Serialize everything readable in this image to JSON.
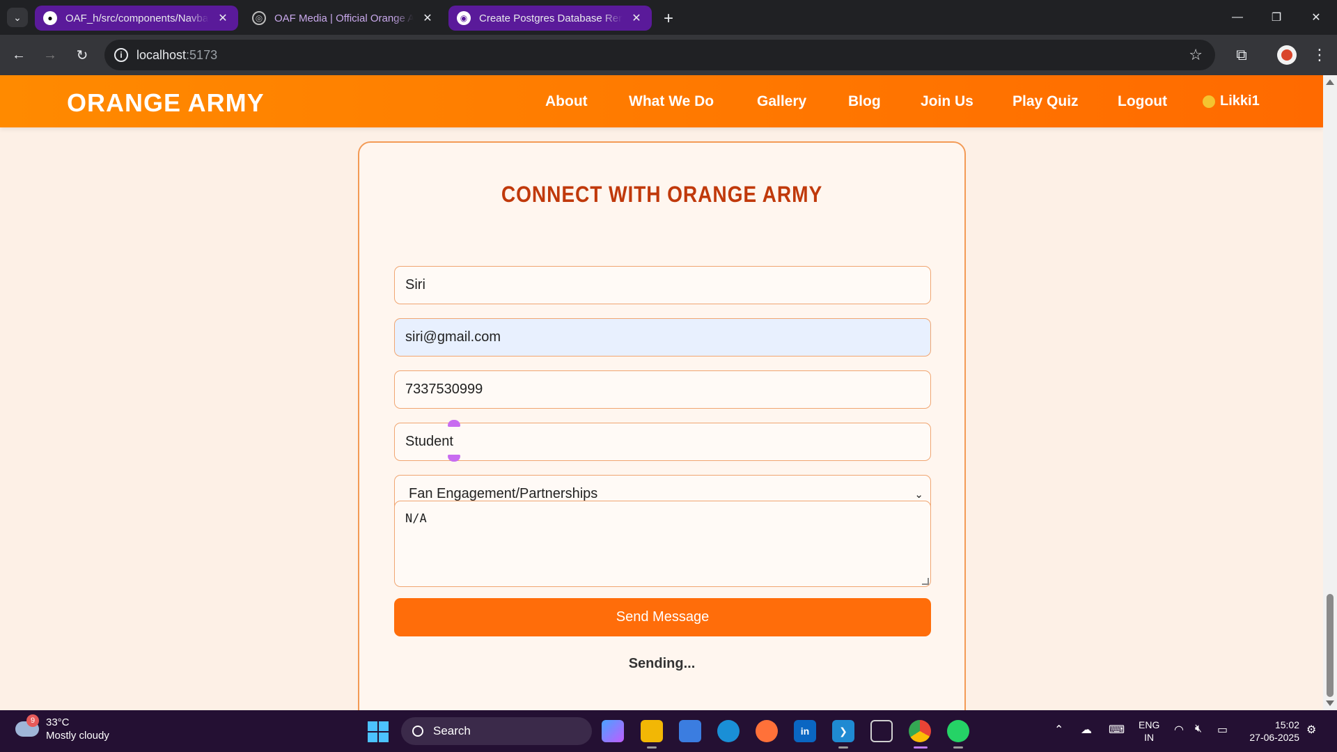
{
  "browser": {
    "tabs": [
      {
        "title": "OAF_h/src/components/Navbar"
      },
      {
        "title": "OAF Media | Official Orange Army"
      },
      {
        "title": "Create Postgres Database Render"
      }
    ],
    "url": {
      "host": "localhost",
      "port": ":5173"
    }
  },
  "site": {
    "logo": "ORANGE ARMY",
    "nav": [
      "About",
      "What We Do",
      "Gallery",
      "Blog",
      "Join Us",
      "Play Quiz",
      "Logout"
    ],
    "user": "Likki1"
  },
  "form": {
    "title": "CONNECT WITH ORANGE ARMY",
    "name": "Siri",
    "email": "siri@gmail.com",
    "phone": "7337530999",
    "occupation": "Student",
    "interest": "Fan Engagement/Partnerships",
    "message": "N/A",
    "submit": "Send Message",
    "status": "Sending..."
  },
  "taskbar": {
    "weather_badge": "9",
    "temperature": "33°C",
    "condition": "Mostly cloudy",
    "search": "Search",
    "lang_line1": "ENG",
    "lang_line2": "IN",
    "time": "15:02",
    "date": "27-06-2025"
  },
  "colors": {
    "brand_orange": "#ff6d0a",
    "title_red": "#c0390b",
    "tab_purple": "#5a1a9a"
  }
}
